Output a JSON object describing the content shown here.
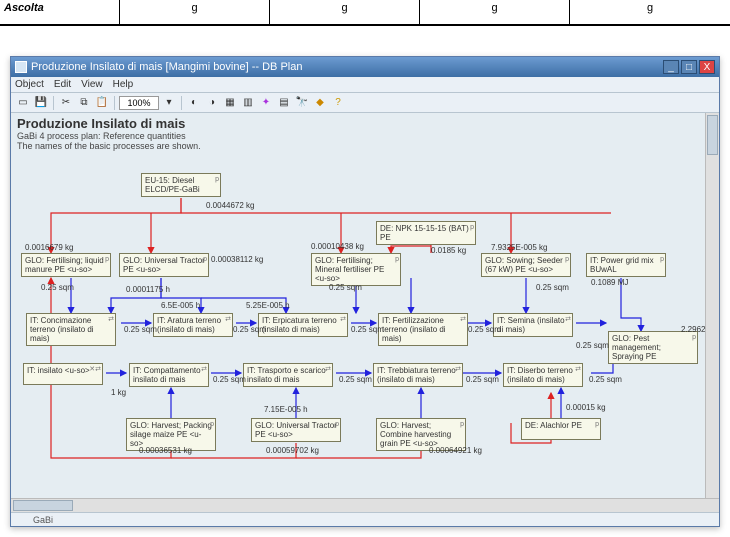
{
  "table_fragment": {
    "c0": "Ascolta",
    "c1": "g",
    "c2": "g",
    "c3": "g",
    "c4": "g"
  },
  "window": {
    "title": "Produzione Insilato di mais [Mangimi bovine] -- DB Plan",
    "min": "_",
    "max": "□",
    "close": "X"
  },
  "menu": {
    "object": "Object",
    "edit": "Edit",
    "view": "View",
    "help": "Help"
  },
  "toolbar": {
    "zoom": "100%"
  },
  "plan": {
    "title": "Produzione Insilato di mais",
    "sub1": "GaBi 4 process plan: Reference quantities",
    "sub2": "The names of the basic processes are shown."
  },
  "nodes": {
    "diesel": "EU-15: Diesel ELCD/PE-GaBi",
    "npk": "DE: NPK 15-15-15 (BAT) PE",
    "fert_liquid": "GLO: Fertilising; liquid manure PE <u-so>",
    "tractor1": "GLO: Universal Tractor PE <u-so>",
    "fert_mineral": "GLO: Fertilising; Mineral fertiliser PE <u-so>",
    "sowing": "GLO: Sowing; Seeder (67 kW) PE <u-so>",
    "powergrid": "IT: Power grid mix BUwAL",
    "concimazione": "IT: Concimazione terreno (insilato di mais)",
    "aratura": "IT: Aratura terreno (insilato di mais)",
    "erpicatura": "IT: Erpicatura terreno (insilato di mais)",
    "fertilizzazione": "IT: Fertilizzazione terreno (insilato di mais)",
    "semina": "IT: Semina (insilato di mais)",
    "pest": "GLO: Pest management; Spraying PE",
    "insilato": "IT: insilato <u-so>",
    "compattamento": "IT: Compattamento insilato di mais",
    "trasporto": "IT: Trasporto e scarico insilato di mais",
    "trebbiatura": "IT: Trebbiatura terreno (insilato di mais)",
    "diserbo": "IT: Diserbo terreno (insilato di mais)",
    "harvest_pack": "GLO: Harvest; Packing silage maize PE <u-so>",
    "tractor2": "GLO: Universal Tractor PE <u-so>",
    "harvest_combine": "GLO: Harvest; Combine harvesting grain PE <u-so>",
    "alachlor": "DE: Alachlor PE"
  },
  "edges": {
    "e1": "0.0044672 kg",
    "e2": "0.0016679 kg",
    "e3": "0.00038112 kg",
    "e4": "0.00010438 kg",
    "e5": "0.0185 kg",
    "e6": "7.9325E-005 kg",
    "e7": "0.25 sqm",
    "e8": "0.0001175 h",
    "e9": "6.5E-005 h",
    "e10": "5.25E-005 h",
    "e11": "0.25 sqm",
    "e12": "0.25 sqm",
    "e13": "0.25 sqm",
    "e14": "0.25 sqm",
    "e15": "0.1089 MJ",
    "e16": "0.25 sqm",
    "e17": "1 kg",
    "e18": "0.25 sqm",
    "e19": "7.15E-005 h",
    "e20": "0.25 sqm",
    "e21": "0.25 sqm",
    "e22": "0.00015 kg",
    "e23": "0.00036531 kg",
    "e24": "0.00059702 kg",
    "e25": "0.00064921 kg",
    "e26": "2.2962"
  },
  "status": {
    "left": " ",
    "mid": "GaBi",
    "right": " "
  }
}
